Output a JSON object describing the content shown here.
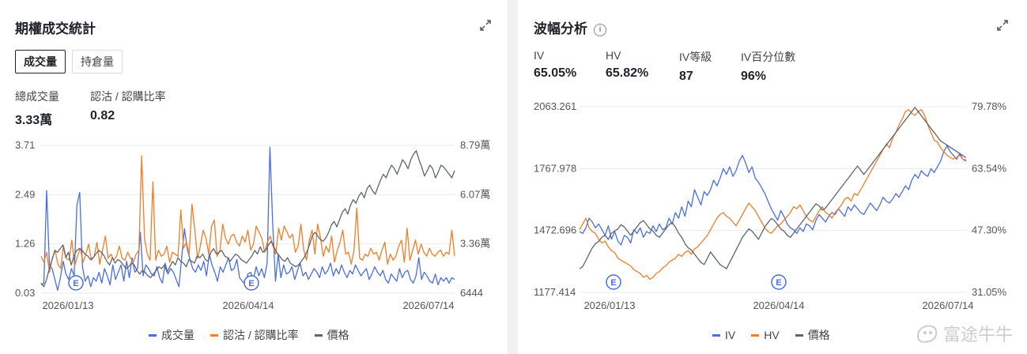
{
  "left": {
    "title": "期權成交統計",
    "tabs": [
      "成交量",
      "持倉量"
    ],
    "stats": [
      {
        "label": "總成交量",
        "value": "3.33萬"
      },
      {
        "label": "認沽 / 認購比率",
        "value": "0.82"
      }
    ],
    "legend": [
      "成交量",
      "認沽 / 認購比率",
      "價格"
    ]
  },
  "right": {
    "title": "波幅分析",
    "info_icon": "i",
    "stats": [
      {
        "label": "IV",
        "value": "65.05%"
      },
      {
        "label": "HV",
        "value": "65.82%"
      },
      {
        "label": "IV等級",
        "value": "87"
      },
      {
        "label": "IV百分位數",
        "value": "96%"
      }
    ],
    "legend": [
      "IV",
      "HV",
      "價格"
    ]
  },
  "watermark": "富途牛牛",
  "colors": {
    "blue": "#4a6ee0",
    "orange": "#f07d28",
    "gray": "#5c6670"
  },
  "chart_data": [
    {
      "type": "line",
      "x_ticks": [
        "2026/01/13",
        "2026/04/14",
        "2026/07/14"
      ],
      "left_axis_ticks": [
        "3.71",
        "2.49",
        "1.26",
        "0.03"
      ],
      "right_axis_ticks": [
        "8.79萬",
        "6.07萬",
        "3.36萬",
        "6444"
      ],
      "ylim_left": [
        0.03,
        3.71
      ],
      "ylim_right": [
        6444,
        87900
      ],
      "markers": [
        "E",
        "E"
      ],
      "series": [
        {
          "name": "成交量",
          "axis": "right",
          "color": "#4a6ee0",
          "values": [
            11000,
            12000,
            63000,
            22000,
            20000,
            14000,
            8000,
            15000,
            24000,
            17000,
            14000,
            20000,
            16000,
            55000,
            62000,
            21000,
            13000,
            16000,
            10000,
            15000,
            13000,
            18000,
            12000,
            20000,
            16000,
            11000,
            22000,
            14000,
            18000,
            22000,
            13000,
            24000,
            15000,
            26000,
            18000,
            20000,
            40000,
            16000,
            22000,
            20000,
            17000,
            16000,
            21000,
            15000,
            12000,
            23000,
            17000,
            20000,
            18000,
            14000,
            10000,
            26000,
            42000,
            31000,
            25000,
            20000,
            18000,
            22000,
            19000,
            24000,
            16000,
            28000,
            22000,
            18000,
            13000,
            21000,
            18000,
            22000,
            26000,
            19000,
            20000,
            25000,
            15000,
            13000,
            11000,
            17000,
            18000,
            14000,
            21000,
            16000,
            20000,
            15000,
            23000,
            87000,
            45000,
            13000,
            28000,
            15000,
            22000,
            17000,
            18000,
            21000,
            14000,
            19000,
            23000,
            16000,
            18000,
            14000,
            17000,
            20000,
            18000,
            15000,
            21000,
            17000,
            19000,
            23000,
            16000,
            20000,
            17000,
            22000,
            18000,
            15000,
            19000,
            17000,
            22000,
            19000,
            16000,
            18000,
            20000,
            14000,
            17000,
            21000,
            18000,
            16000,
            19000,
            14000,
            12000,
            17000,
            15000,
            13000,
            20000,
            15000,
            18000,
            19000,
            14000,
            12000,
            16000,
            26000,
            14000,
            18000,
            16000,
            13000,
            12000,
            17000,
            11000,
            15000,
            13000,
            15000,
            12000,
            15000,
            14000
          ]
        },
        {
          "name": "認沽 / 認購比率",
          "axis": "left",
          "color": "#f07d28",
          "values": [
            0.95,
            0.8,
            1.05,
            0.55,
            0.9,
            1.1,
            0.75,
            0.65,
            1.2,
            0.9,
            0.85,
            1.35,
            0.7,
            0.95,
            1.15,
            0.8,
            1.0,
            1.25,
            0.85,
            0.95,
            1.3,
            0.75,
            1.1,
            1.45,
            0.9,
            1.0,
            0.85,
            0.95,
            1.2,
            0.9,
            0.85,
            1.05,
            0.9,
            0.8,
            1.0,
            1.1,
            3.45,
            1.4,
            1.0,
            0.85,
            2.8,
            0.85,
            1.1,
            0.95,
            1.0,
            1.2,
            0.8,
            1.05,
            1.0,
            0.95,
            2.1,
            1.15,
            1.3,
            1.0,
            2.25,
            1.6,
            0.9,
            1.2,
            1.6,
            1.4,
            1.0,
            1.7,
            1.85,
            0.95,
            1.1,
            1.75,
            1.4,
            1.25,
            1.45,
            1.5,
            1.3,
            1.2,
            1.45,
            1.3,
            1.6,
            1.1,
            1.25,
            1.7,
            1.55,
            1.4,
            1.05,
            1.3,
            1.45,
            1.2,
            1.0,
            1.65,
            1.35,
            1.7,
            1.55,
            1.4,
            1.5,
            1.05,
            1.2,
            1.75,
            1.1,
            0.85,
            1.35,
            1.6,
            1.0,
            1.75,
            1.4,
            0.95,
            1.2,
            1.05,
            1.45,
            0.8,
            1.1,
            1.3,
            1.6,
            1.0,
            1.05,
            0.75,
            1.1,
            2.15,
            0.9,
            0.85,
            1.0,
            0.95,
            1.15,
            1.0,
            1.05,
            0.85,
            1.1,
            1.3,
            0.75,
            1.0,
            0.85,
            0.95,
            1.2,
            1.35,
            0.8,
            1.65,
            0.85,
            1.1,
            1.35,
            1.0,
            1.25,
            1.05,
            0.95,
            1.15,
            1.0,
            0.95,
            1.05,
            1.1,
            0.95,
            1.05,
            1.0,
            1.6,
            0.95
          ]
        },
        {
          "name": "價格",
          "axis": "right",
          "color": "#5c6670",
          "values": [
            12000,
            10000,
            14000,
            20000,
            25000,
            30000,
            29000,
            31000,
            33000,
            26000,
            29000,
            22000,
            27000,
            30000,
            31000,
            30000,
            28000,
            27000,
            25000,
            26000,
            28000,
            30000,
            29000,
            27000,
            24000,
            22000,
            26000,
            23000,
            25000,
            24000,
            22000,
            20000,
            21000,
            23000,
            22000,
            19000,
            17000,
            19000,
            18000,
            16000,
            15000,
            17000,
            19000,
            21000,
            20000,
            22000,
            18000,
            21000,
            24000,
            22000,
            26000,
            24000,
            23000,
            21000,
            25000,
            24000,
            23000,
            27000,
            26000,
            28000,
            25000,
            24000,
            29000,
            31000,
            28000,
            29000,
            30000,
            27000,
            26000,
            24000,
            26000,
            28000,
            27000,
            25000,
            24000,
            23000,
            25000,
            27000,
            30000,
            28000,
            32000,
            29000,
            30000,
            33000,
            35000,
            32000,
            29000,
            27000,
            25000,
            24000,
            26000,
            23000,
            22000,
            21000,
            22000,
            24000,
            26000,
            29000,
            33000,
            38000,
            40000,
            38000,
            36000,
            35000,
            37000,
            40000,
            44000,
            46000,
            43000,
            47000,
            51000,
            53000,
            50000,
            55000,
            58000,
            56000,
            60000,
            62000,
            59000,
            64000,
            66000,
            63000,
            61000,
            65000,
            69000,
            72000,
            70000,
            74000,
            77000,
            75000,
            72000,
            76000,
            80000,
            78000,
            75000,
            80000,
            83000,
            85000,
            80000,
            76000,
            71000,
            74000,
            77000,
            75000,
            70000,
            73000,
            77000,
            76000,
            74000,
            72000,
            70000,
            74000
          ]
        }
      ]
    },
    {
      "type": "line",
      "x_ticks": [
        "2026/01/13",
        "2026/04/14",
        "2026/07/14"
      ],
      "left_axis_ticks": [
        "2063.261",
        "1767.978",
        "1472.696",
        "1177.414"
      ],
      "right_axis_ticks": [
        "79.78%",
        "63.54%",
        "47.30%",
        "31.05%"
      ],
      "ylim_left": [
        1177.414,
        2063.261
      ],
      "ylim_right": [
        31.05,
        79.78
      ],
      "markers": [
        "E",
        "E"
      ],
      "series": [
        {
          "name": "IV",
          "axis": "right",
          "color": "#4a6ee0",
          "values": [
            47.0,
            46.5,
            48.0,
            50.5,
            49.5,
            48.0,
            49.0,
            47.5,
            46.0,
            48.5,
            45.0,
            47.0,
            44.5,
            43.5,
            46.0,
            45.5,
            44.0,
            47.5,
            46.5,
            48.0,
            45.5,
            47.0,
            46.5,
            48.5,
            47.0,
            49.0,
            47.5,
            48.0,
            50.5,
            49.0,
            52.0,
            50.5,
            53.5,
            51.0,
            55.0,
            53.5,
            58.0,
            56.0,
            54.0,
            57.5,
            56.5,
            58.0,
            60.5,
            59.0,
            61.0,
            63.5,
            62.0,
            64.0,
            61.5,
            63.0,
            65.5,
            67.0,
            65.0,
            62.5,
            64.0,
            61.0,
            60.0,
            58.5,
            57.0,
            55.0,
            53.0,
            51.5,
            50.0,
            52.5,
            51.0,
            49.0,
            48.0,
            47.5,
            46.5,
            48.0,
            47.0,
            49.0,
            48.5,
            47.5,
            50.0,
            51.5,
            50.5,
            49.5,
            51.0,
            52.0,
            51.5,
            53.0,
            52.0,
            51.0,
            53.5,
            52.5,
            54.0,
            53.0,
            52.0,
            51.5,
            53.0,
            54.5,
            53.5,
            52.5,
            54.0,
            56.0,
            55.0,
            54.5,
            55.5,
            57.0,
            56.0,
            57.5,
            59.0,
            58.0,
            60.5,
            62.0,
            61.0,
            63.0,
            62.0,
            61.5,
            63.5,
            62.5,
            64.0,
            65.5,
            68.0,
            69.5,
            68.0,
            67.0,
            66.0,
            67.5,
            66.0,
            65.5
          ]
        },
        {
          "name": "HV",
          "axis": "right",
          "color": "#f07d28",
          "values": [
            47.5,
            49.0,
            50.5,
            48.0,
            47.0,
            46.5,
            45.0,
            44.0,
            44.5,
            43.0,
            42.0,
            41.5,
            40.0,
            39.5,
            39.0,
            38.5,
            38.0,
            37.0,
            36.5,
            36.0,
            35.0,
            35.5,
            34.5,
            35.0,
            36.0,
            36.5,
            37.5,
            38.0,
            39.0,
            39.5,
            40.0,
            41.0,
            40.5,
            41.5,
            42.0,
            41.0,
            42.5,
            43.0,
            44.0,
            45.0,
            46.0,
            47.5,
            49.0,
            50.5,
            51.5,
            52.0,
            51.0,
            50.5,
            49.5,
            48.5,
            50.0,
            51.5,
            53.0,
            54.5,
            53.5,
            52.5,
            51.0,
            49.5,
            48.0,
            47.0,
            46.5,
            47.5,
            48.5,
            49.0,
            50.0,
            51.0,
            52.0,
            53.5,
            53.0,
            54.0,
            52.5,
            51.0,
            50.0,
            49.5,
            51.0,
            52.5,
            53.5,
            52.0,
            51.5,
            50.5,
            52.0,
            53.0,
            54.0,
            55.5,
            56.0,
            55.0,
            57.0,
            56.5,
            58.0,
            59.5,
            61.0,
            62.5,
            64.0,
            65.5,
            67.0,
            68.5,
            70.0,
            69.0,
            71.5,
            73.0,
            75.0,
            76.5,
            78.5,
            79.0,
            78.0,
            77.5,
            78.5,
            79.0,
            77.5,
            75.0,
            73.0,
            71.0,
            70.5,
            69.0,
            68.0,
            67.0,
            66.5,
            66.0,
            66.5,
            67.0,
            66.0,
            65.8
          ]
        },
        {
          "name": "價格",
          "axis": "left",
          "color": "#5c6670",
          "values": [
            1290,
            1300,
            1330,
            1360,
            1390,
            1410,
            1420,
            1440,
            1450,
            1430,
            1460,
            1470,
            1480,
            1500,
            1490,
            1470,
            1450,
            1470,
            1490,
            1510,
            1520,
            1500,
            1480,
            1470,
            1450,
            1440,
            1460,
            1480,
            1500,
            1510,
            1490,
            1460,
            1440,
            1410,
            1390,
            1380,
            1360,
            1340,
            1320,
            1310,
            1340,
            1370,
            1350,
            1330,
            1310,
            1300,
            1290,
            1320,
            1350,
            1380,
            1410,
            1440,
            1460,
            1480,
            1470,
            1450,
            1430,
            1460,
            1490,
            1510,
            1530,
            1520,
            1500,
            1480,
            1470,
            1450,
            1440,
            1460,
            1480,
            1500,
            1520,
            1540,
            1560,
            1580,
            1600,
            1590,
            1570,
            1580,
            1600,
            1620,
            1640,
            1660,
            1680,
            1700,
            1720,
            1740,
            1760,
            1780,
            1760,
            1740,
            1760,
            1780,
            1800,
            1820,
            1840,
            1860,
            1880,
            1900,
            1920,
            1940,
            1960,
            1980,
            2000,
            2020,
            2040,
            2060,
            2040,
            2020,
            2000,
            1980,
            1960,
            1940,
            1920,
            1900,
            1890,
            1880,
            1870,
            1860,
            1850,
            1840,
            1830,
            1820
          ]
        }
      ]
    }
  ]
}
